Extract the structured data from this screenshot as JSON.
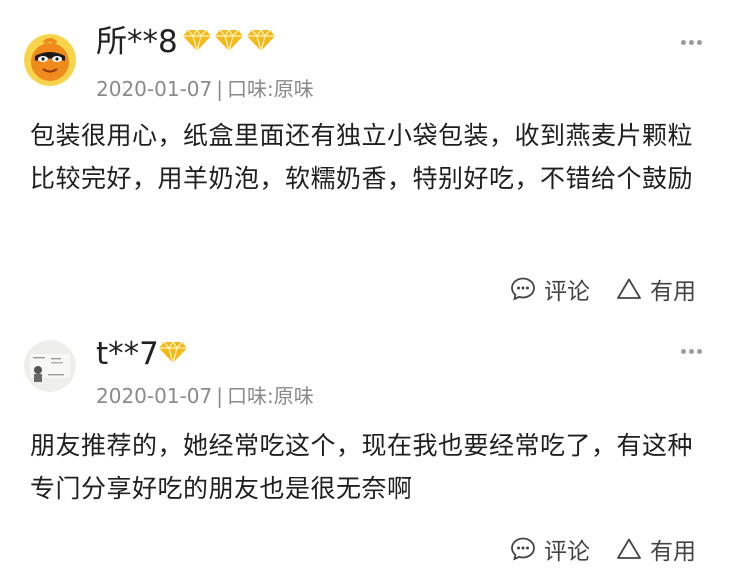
{
  "reviews": [
    {
      "username": "所**8",
      "badge_count": 3,
      "date": "2020-01-07",
      "separator": "|",
      "flavor": "口味:原味",
      "content": "包装很用心，纸盒里面还有独立小袋包装，收到燕麦片颗粒比较完好，用羊奶泡，软糯奶香，特别好吃，不错给个鼓励",
      "comment_label": "评论",
      "useful_label": "有用",
      "avatar_icon": "orange-masked-mascot-avatar"
    },
    {
      "username": "t**7",
      "badge_count": 1,
      "date": "2020-01-07",
      "separator": "|",
      "flavor": "口味:原味",
      "content": "朋友推荐的，她经常吃这个，现在我也要经常吃了，有这种专门分享好吃的朋友也是很无奈啊",
      "comment_label": "评论",
      "useful_label": "有用",
      "avatar_icon": "photo-avatar"
    }
  ],
  "colors": {
    "diamond": "#f5b817",
    "meta_text": "#8a8a8a",
    "body_text": "#1f1f1f",
    "action_text": "#444444"
  }
}
